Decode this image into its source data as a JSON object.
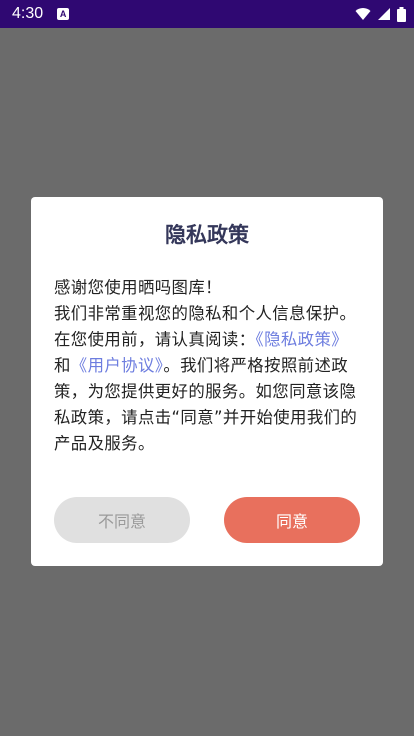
{
  "status_bar": {
    "time": "4:30",
    "notification_icon_letter": "A",
    "icons": [
      "wifi-icon",
      "signal-icon",
      "battery-icon"
    ]
  },
  "dialog": {
    "title": "隐私政策",
    "body": {
      "line1": "感谢您使用晒吗图库！",
      "text1": "我们非常重视您的隐私和个人信息保护。在您使用前，请认真阅读：",
      "link1": "《隐私政策》",
      "text2": "和",
      "link2": "《用户协议》",
      "text3": "。我们将严格按照前述政策，为您提供更好的服务。如您同意该隐私政策，请点击“同意”并开始使用我们的产品及服务。"
    },
    "buttons": {
      "disagree": "不同意",
      "agree": "同意"
    }
  },
  "colors": {
    "status_bar": "#2f0872",
    "overlay": "#6b6b6b",
    "link": "#6d7ddf",
    "agree_button": "#e8705d",
    "disagree_button": "#e0e0e0"
  }
}
